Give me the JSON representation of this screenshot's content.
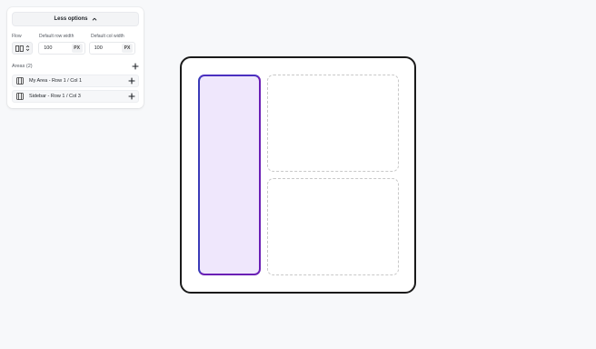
{
  "panel": {
    "toggle_label": "Less options",
    "flow_label": "Flow",
    "row_width_label": "Default row width",
    "row_width_value": "100",
    "row_width_unit": "PX",
    "col_width_label": "Default col width",
    "col_width_value": "100",
    "col_width_unit": "PX",
    "areas_title": "Areas (2)",
    "areas": [
      {
        "label": "My Area - Row 1 / Col 1"
      },
      {
        "label": "Sidebar - Row 1 / Col 3"
      }
    ]
  },
  "canvas": {
    "area_fill": "#efe7fc",
    "area_border": "#6a1fb5"
  },
  "icons": {
    "toggle": "chevron-up-icon",
    "flow": "columns-icon",
    "stepper": "up-down-chevrons-icon",
    "add": "plus-icon",
    "area": "grid-layout-icon"
  }
}
